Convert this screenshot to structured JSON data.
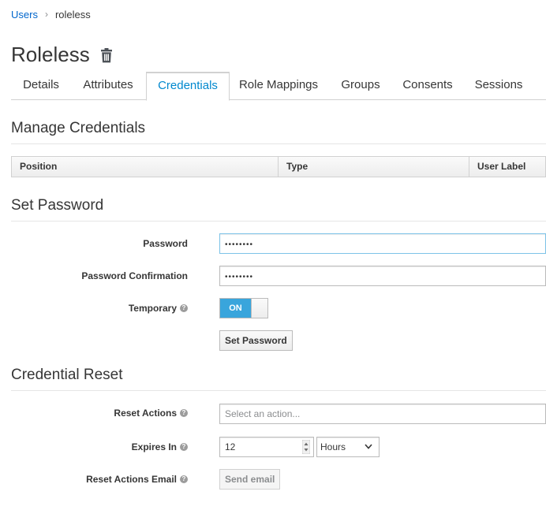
{
  "breadcrumb": {
    "parent": "Users",
    "current": "roleless"
  },
  "page": {
    "title": "Roleless"
  },
  "tabs": [
    {
      "label": "Details"
    },
    {
      "label": "Attributes"
    },
    {
      "label": "Credentials"
    },
    {
      "label": "Role Mappings"
    },
    {
      "label": "Groups"
    },
    {
      "label": "Consents"
    },
    {
      "label": "Sessions"
    }
  ],
  "active_tab": "Credentials",
  "manage": {
    "heading": "Manage Credentials",
    "columns": [
      "Position",
      "Type",
      "User Label"
    ]
  },
  "set_password": {
    "heading": "Set Password",
    "password_label": "Password",
    "password_value": "••••••••",
    "confirm_label": "Password Confirmation",
    "confirm_value": "••••••••",
    "temporary_label": "Temporary",
    "temporary_state": "ON",
    "button_label": "Set Password"
  },
  "reset": {
    "heading": "Credential Reset",
    "actions_label": "Reset Actions",
    "actions_placeholder": "Select an action...",
    "expires_label": "Expires In",
    "expires_value": "12",
    "expires_unit": "Hours",
    "email_label": "Reset Actions Email",
    "email_button": "Send email"
  },
  "colors": {
    "accent": "#0088ce",
    "toggle_on": "#39a5dc",
    "link": "#0066cc"
  },
  "icons": {
    "delete": "trash-icon",
    "help": "question-circle-icon",
    "spinner": "spinner-arrows-icon",
    "dropdown": "chevron-down-icon"
  }
}
